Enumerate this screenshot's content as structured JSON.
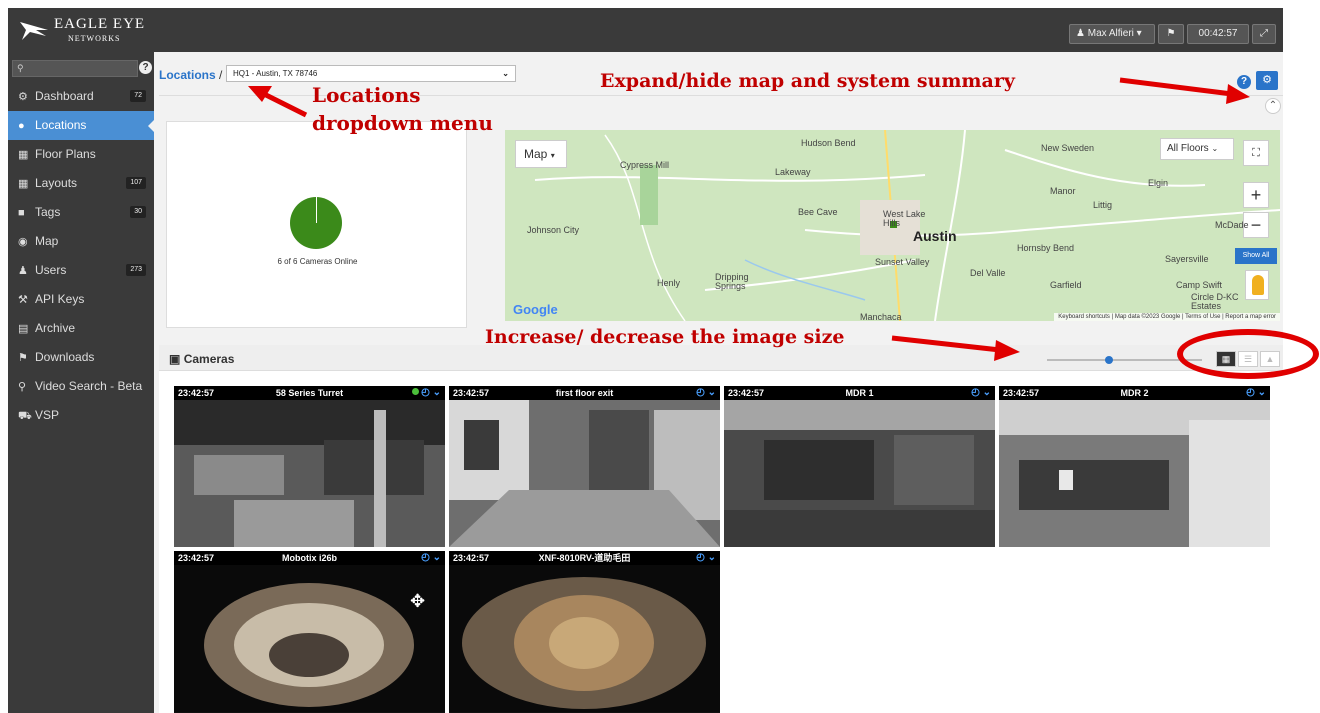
{
  "app": {
    "logo_line1": "EAGLE EYE",
    "logo_line2": "NETWORKS",
    "user_menu": "Max Alfieri",
    "clock": "00:42:57"
  },
  "sidebar": {
    "search_placeholder": "",
    "items": [
      {
        "icon": "dashboard-icon",
        "label": "Dashboard",
        "badge": "72"
      },
      {
        "icon": "location-pin-icon",
        "label": "Locations",
        "badge": ""
      },
      {
        "icon": "floor-plans-icon",
        "label": "Floor Plans",
        "badge": ""
      },
      {
        "icon": "layouts-icon",
        "label": "Layouts",
        "badge": "107"
      },
      {
        "icon": "tags-icon",
        "label": "Tags",
        "badge": "30"
      },
      {
        "icon": "globe-icon",
        "label": "Map",
        "badge": ""
      },
      {
        "icon": "users-icon",
        "label": "Users",
        "badge": "273"
      },
      {
        "icon": "wrench-icon",
        "label": "API Keys",
        "badge": ""
      },
      {
        "icon": "folder-icon",
        "label": "Archive",
        "badge": ""
      },
      {
        "icon": "downloads-icon",
        "label": "Downloads",
        "badge": ""
      },
      {
        "icon": "search-icon",
        "label": "Video Search - Beta",
        "badge": ""
      },
      {
        "icon": "car-icon",
        "label": "VSP",
        "badge": ""
      }
    ],
    "active_index": 1
  },
  "header": {
    "breadcrumb": "Locations",
    "location_value": "HQ1 - Austin, TX 78746"
  },
  "summary": {
    "online_text": "6 of 6 Cameras Online",
    "online": 6,
    "total": 6,
    "pie_color": "#3b8a1a"
  },
  "map": {
    "type_button": "Map",
    "floors_select": "All Floors",
    "show_all": "Show All",
    "footer": "Keyboard shortcuts  |  Map data ©2023 Google  |  Terms of Use  |  Report a map error",
    "google": "Google",
    "labels": [
      "Hudson Bend",
      "New Sweden",
      "Cypress Mill",
      "Lakeway",
      "Manor",
      "Elgin",
      "Littig",
      "Bee Cave",
      "West Lake Hills",
      "Johnson City",
      "Austin",
      "Hornsby Bend",
      "McDade",
      "Sunset Valley",
      "Del Valle",
      "Sayersville",
      "Henly",
      "Dripping Springs",
      "Garfield",
      "Camp Swift",
      "Circle D-KC Estates",
      "Manchaca"
    ]
  },
  "cameras": {
    "title": "Cameras",
    "tiles": [
      {
        "time": "23:42:57",
        "name": "58 Series Turret",
        "status": "green"
      },
      {
        "time": "23:42:57",
        "name": "first floor exit",
        "status": ""
      },
      {
        "time": "23:42:57",
        "name": "MDR 1",
        "status": ""
      },
      {
        "time": "23:42:57",
        "name": "MDR 2",
        "status": ""
      },
      {
        "time": "23:42:57",
        "name": "Mobotix i26b",
        "status": ""
      },
      {
        "time": "23:42:57",
        "name": "XNF-8010RV-道助毛田",
        "status": ""
      }
    ]
  },
  "annotations": {
    "locations": "Locations",
    "dropdown": "dropdown menu",
    "expand": "Expand/hide map and system summary",
    "image_size": "Increase/ decrease the image size",
    "color": "#c00000"
  }
}
